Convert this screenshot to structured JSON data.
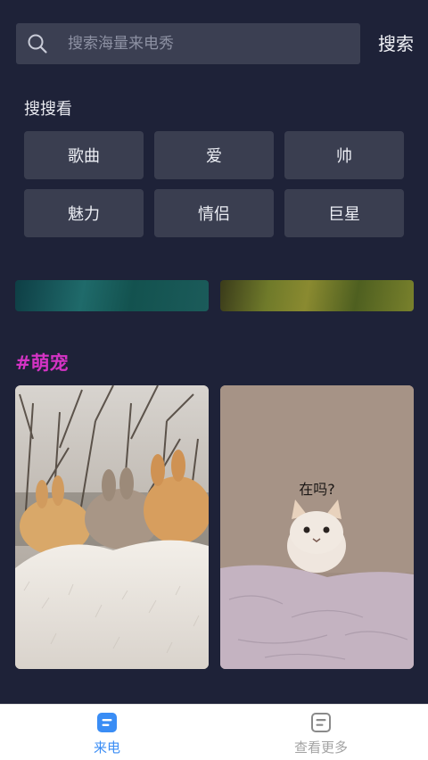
{
  "search": {
    "placeholder": "搜索海量来电秀",
    "button_label": "搜索"
  },
  "discover": {
    "title": "搜搜看",
    "tags": [
      "歌曲",
      "爱",
      "帅",
      "魅力",
      "情侣",
      "巨星"
    ]
  },
  "category": {
    "title": "#萌宠",
    "cards": [
      {
        "caption": ""
      },
      {
        "caption": "在吗?"
      }
    ]
  },
  "tabbar": {
    "tabs": [
      {
        "label": "来电",
        "icon": "call-show-icon",
        "active": true
      },
      {
        "label": "查看更多",
        "icon": "more-list-icon",
        "active": false
      }
    ]
  },
  "colors": {
    "background": "#1e2238",
    "tag_bg": "#3a3e50",
    "category_title": "#d433c4",
    "tab_active": "#3a8df5",
    "tab_inactive": "#a3a3a3"
  }
}
